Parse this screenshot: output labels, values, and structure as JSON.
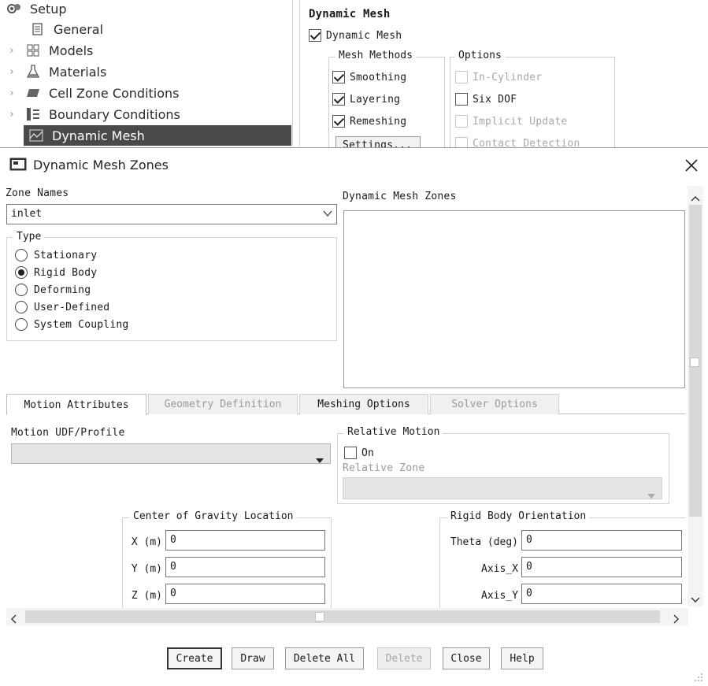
{
  "tree": {
    "items": [
      {
        "label": "Setup",
        "icon": "setup-icon"
      },
      {
        "label": "General",
        "icon": "general-icon"
      },
      {
        "label": "Models",
        "icon": "models-icon"
      },
      {
        "label": "Materials",
        "icon": "materials-icon"
      },
      {
        "label": "Cell Zone Conditions",
        "icon": "cell-zone-icon"
      },
      {
        "label": "Boundary Conditions",
        "icon": "boundary-icon"
      },
      {
        "label": "Dynamic Mesh",
        "icon": "dynamic-mesh-icon"
      }
    ]
  },
  "dynamic_mesh_panel": {
    "heading": "Dynamic Mesh",
    "enable_label": "Dynamic Mesh",
    "mesh_methods": {
      "title": "Mesh Methods",
      "items": [
        {
          "label": "Smoothing",
          "checked": true
        },
        {
          "label": "Layering",
          "checked": true
        },
        {
          "label": "Remeshing",
          "checked": true
        }
      ],
      "settings_label": "Settings..."
    },
    "options": {
      "title": "Options",
      "items": [
        {
          "label": "In-Cylinder",
          "checked": false,
          "disabled": true
        },
        {
          "label": "Six DOF",
          "checked": false,
          "disabled": false
        },
        {
          "label": "Implicit Update",
          "checked": false,
          "disabled": true
        },
        {
          "label": "Contact Detection",
          "checked": false,
          "disabled": true
        }
      ]
    }
  },
  "dialog": {
    "title": "Dynamic Mesh Zones",
    "zone_names": {
      "label": "Zone Names",
      "value": "inlet"
    },
    "type": {
      "label": "Type",
      "options": [
        "Stationary",
        "Rigid Body",
        "Deforming",
        "User-Defined",
        "System Coupling"
      ],
      "selected": "Rigid Body"
    },
    "zones_list_label": "Dynamic Mesh Zones",
    "tabs": [
      {
        "label": "Motion Attributes",
        "state": "active"
      },
      {
        "label": "Geometry Definition",
        "state": "disabled"
      },
      {
        "label": "Meshing Options",
        "state": "normal"
      },
      {
        "label": "Solver Options",
        "state": "disabled"
      }
    ],
    "motion_udf_label": "Motion UDF/Profile",
    "relative_motion": {
      "title": "Relative Motion",
      "on_label": "On",
      "checked": false,
      "zone_label": "Relative Zone"
    },
    "cog": {
      "title": "Center of Gravity Location",
      "fields": [
        {
          "label": "X (m)",
          "value": "0"
        },
        {
          "label": "Y (m)",
          "value": "0"
        },
        {
          "label": "Z (m)",
          "value": "0"
        }
      ]
    },
    "orientation": {
      "title": "Rigid Body Orientation",
      "fields": [
        {
          "label": "Theta (deg)",
          "value": "0"
        },
        {
          "label": "Axis_X",
          "value": "0"
        },
        {
          "label": "Axis_Y",
          "value": "0"
        }
      ]
    },
    "buttons": [
      {
        "label": "Create",
        "state": "default"
      },
      {
        "label": "Draw",
        "state": "normal"
      },
      {
        "label": "Delete All",
        "state": "normal"
      },
      {
        "label": "Delete",
        "state": "disabled"
      },
      {
        "label": "Close",
        "state": "normal"
      },
      {
        "label": "Help",
        "state": "normal"
      }
    ]
  }
}
